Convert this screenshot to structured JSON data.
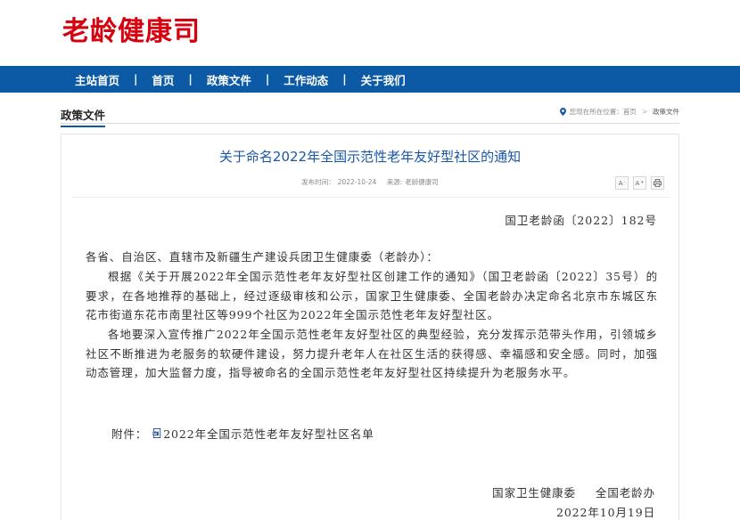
{
  "site": {
    "logo": "老龄健康司"
  },
  "nav": {
    "items": [
      {
        "label": "主站首页"
      },
      {
        "label": "首页"
      },
      {
        "label": "政策文件"
      },
      {
        "label": "工作动态"
      },
      {
        "label": "关于我们"
      }
    ],
    "separator": "|"
  },
  "section": {
    "title": "政策文件",
    "location_label": "您现在所在位置：",
    "breadcrumb": [
      "首页",
      "政策文件"
    ],
    "breadcrumb_sep": ">"
  },
  "article": {
    "title": "关于命名2022年全国示范性老年友好型社区的通知",
    "publish_label": "发布时间：",
    "publish_date": "2022-10-24",
    "source_label": "来源:",
    "source": "老龄健康司",
    "tools": {
      "font_small": "A",
      "font_large": "A",
      "font_small_sup": "-",
      "font_large_sup": "+"
    },
    "doc_number": "国卫老龄函〔2022〕182号",
    "paragraphs": [
      "各省、自治区、直辖市及新疆生产建设兵团卫生健康委（老龄办）：",
      "根据《关于开展2022年全国示范性老年友好型社区创建工作的通知》（国卫老龄函〔2022〕35号）的要求，在各地推荐的基础上，经过逐级审核和公示，国家卫生健康委、全国老龄办决定命名北京市东城区东花市街道东花市南里社区等999个社区为2022年全国示范性老年友好型社区。",
      "各地要深入宣传推广2022年全国示范性老年友好型社区的典型经验，充分发挥示范带头作用，引领城乡社区不断推进为老服务的软硬件建设，努力提升老年人在社区生活的获得感、幸福感和安全感。同时，加强动态管理，加大监督力度，指导被命名的全国示范性老年友好型社区持续提升为老服务水平。"
    ],
    "attachment_label": "附件：",
    "attachment_name": "2022年全国示范性老年友好型社区名单",
    "signature": {
      "org1": "国家卫生健康委",
      "org2": "全国老龄办"
    },
    "date": "2022年10月19日"
  },
  "colors": {
    "brand_red": "#d7000f",
    "nav_blue": "#0c5aa6",
    "title_blue": "#1a56a8"
  },
  "icons": {
    "location": "location-pin-icon",
    "print": "printer-icon",
    "attachment": "file-icon"
  }
}
